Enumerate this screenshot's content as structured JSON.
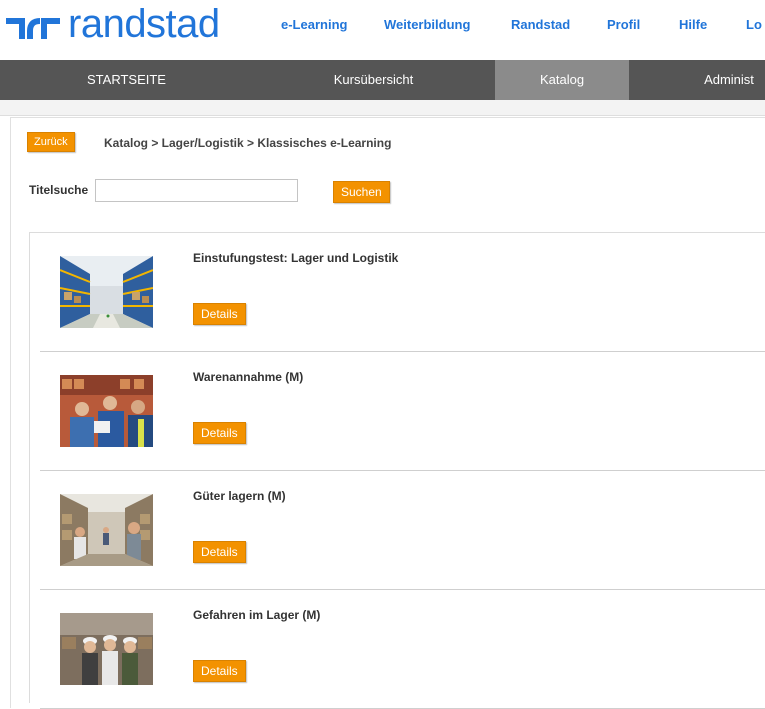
{
  "header": {
    "logo_text": "randstad",
    "links": [
      "e-Learning",
      "Weiterbildung",
      "Randstad",
      "Profil",
      "Hilfe",
      "Lo"
    ]
  },
  "mainnav": {
    "tabs": [
      "STARTSEITE",
      "Kursübersicht",
      "Katalog",
      "Administ"
    ],
    "active_tab": "Katalog"
  },
  "toolbar": {
    "back_label": "Zurück",
    "breadcrumb": "Katalog > Lager/Logistik > Klassisches e-Learning"
  },
  "search": {
    "label": "Titelsuche",
    "value": "",
    "placeholder": "",
    "button_label": "Suchen"
  },
  "courses": [
    {
      "title": "Einstufungstest: Lager und Logistik",
      "button_label": "Details",
      "image": "warehouse-aisle"
    },
    {
      "title": "Warenannahme (M)",
      "button_label": "Details",
      "image": "workers-receiving-goods"
    },
    {
      "title": "Güter lagern (M)",
      "button_label": "Details",
      "image": "warehouse-storage-workers"
    },
    {
      "title": "Gefahren im Lager (M)",
      "button_label": "Details",
      "image": "workers-with-helmets"
    }
  ],
  "colors": {
    "brand_blue": "#2175d9",
    "nav_bg": "#555555",
    "nav_active": "#8b8b8b",
    "button_orange": "#f39200"
  }
}
